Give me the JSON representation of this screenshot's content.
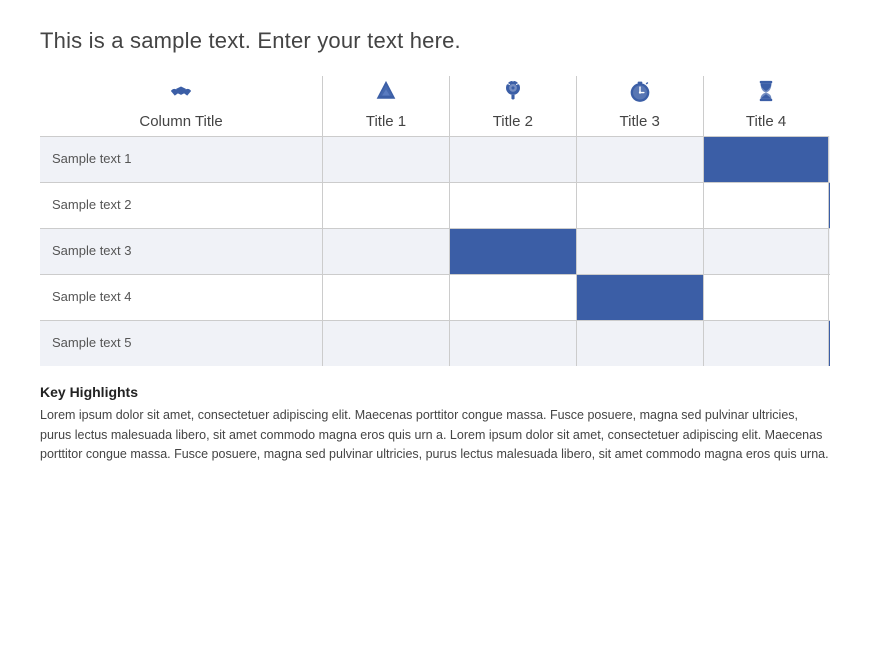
{
  "page": {
    "title": "This is a sample text. Enter your text here."
  },
  "table": {
    "columns": [
      {
        "id": "col0",
        "label": "Column Title",
        "icon": "handshake"
      },
      {
        "id": "col1",
        "label": "Title 1",
        "icon": "pyramid"
      },
      {
        "id": "col2",
        "label": "Title 2",
        "icon": "brain"
      },
      {
        "id": "col3",
        "label": "Title 3",
        "icon": "stopwatch"
      },
      {
        "id": "col4",
        "label": "Title 4",
        "icon": "hourglass"
      }
    ],
    "rows": [
      {
        "label": "Sample text 1",
        "class": "odd",
        "cells": [
          false,
          false,
          false,
          true,
          false
        ]
      },
      {
        "label": "Sample text 2",
        "class": "even",
        "cells": [
          false,
          false,
          false,
          false,
          true
        ]
      },
      {
        "label": "Sample text 3",
        "class": "odd",
        "cells": [
          false,
          true,
          false,
          false,
          false
        ]
      },
      {
        "label": "Sample text 4",
        "class": "even",
        "cells": [
          false,
          false,
          true,
          false,
          false
        ]
      },
      {
        "label": "Sample text 5",
        "class": "odd",
        "cells": [
          false,
          false,
          false,
          false,
          true
        ]
      }
    ]
  },
  "highlights": {
    "title": "Key Highlights",
    "text": "Lorem ipsum dolor sit amet, consectetuer adipiscing elit. Maecenas porttitor congue massa. Fusce posuere, magna sed pulvinar ultricies, purus lectus malesuada libero, sit amet commodo magna eros quis urn a. Lorem ipsum dolor sit amet, consectetuer adipiscing elit. Maecenas porttitor congue massa. Fusce posuere, magna sed pulvinar ultricies, purus lectus malesuada libero, sit amet commodo magna eros quis urna."
  },
  "icons": {
    "handshake": "🤝",
    "pyramid": "▲",
    "brain": "⚙",
    "stopwatch": "⏱",
    "hourglass": "⌛"
  },
  "colors": {
    "accent": "#3b5ea6",
    "text": "#444444",
    "row_odd": "#f0f2f7",
    "row_even": "#ffffff"
  }
}
